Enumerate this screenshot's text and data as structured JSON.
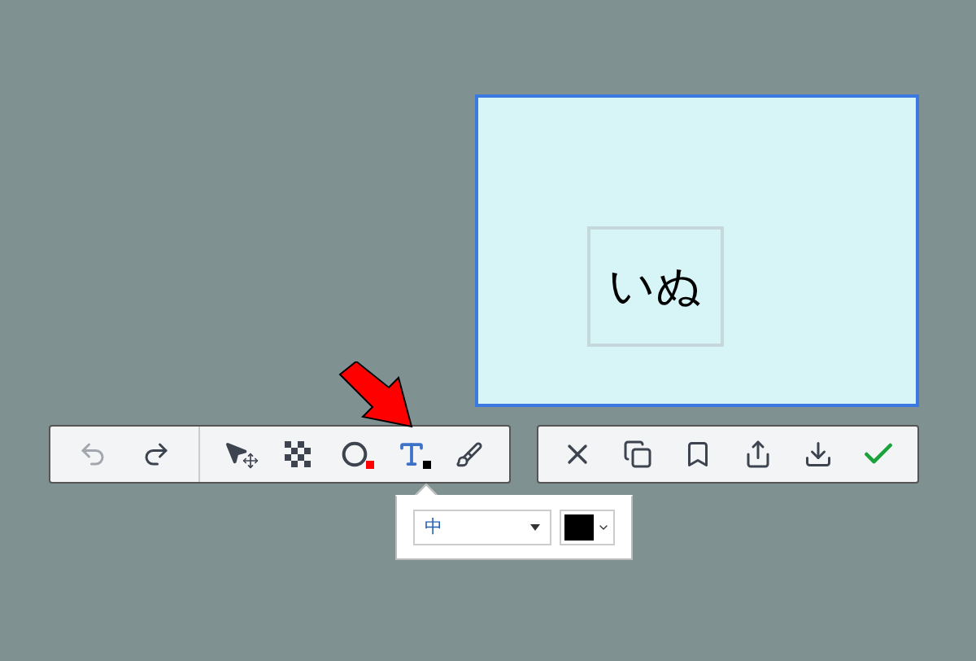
{
  "capture": {
    "text": "いぬ"
  },
  "history": [
    {
      "kind": "undo",
      "disabled": true
    },
    {
      "kind": "redo",
      "disabled": false
    }
  ],
  "tools": [
    {
      "kind": "select",
      "selected": false
    },
    {
      "kind": "mosaic",
      "selected": false
    },
    {
      "kind": "circle",
      "selected": false,
      "color": "#ff0000"
    },
    {
      "kind": "text",
      "selected": true,
      "color": "#000000"
    },
    {
      "kind": "brush",
      "selected": false
    }
  ],
  "actions": [
    {
      "kind": "cancel"
    },
    {
      "kind": "copy"
    },
    {
      "kind": "bookmark"
    },
    {
      "kind": "share"
    },
    {
      "kind": "download"
    },
    {
      "kind": "confirm"
    }
  ],
  "text_options": {
    "size": "中",
    "color": "#000000"
  }
}
